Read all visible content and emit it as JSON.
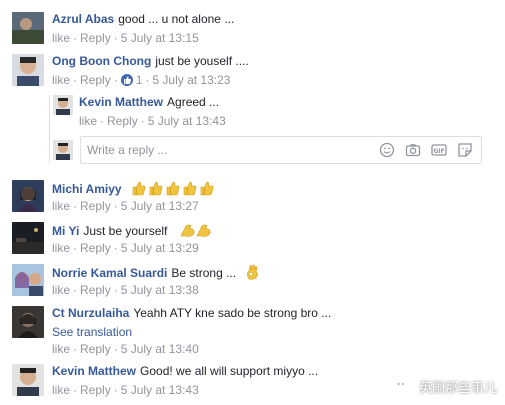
{
  "actions": {
    "like": "like",
    "reply": "Reply",
    "dot": "·"
  },
  "comments": [
    {
      "name": "Azrul Abas",
      "text": "good ... u not alone ...",
      "time": "5 July at 13:15"
    },
    {
      "name": "Ong Boon Chong",
      "text": "just be youself ....",
      "likes": "1",
      "time": "5 July at 13:23"
    },
    {
      "name": "Kevin Matthew",
      "text": "Agreed ...",
      "time": "5 July at 13:43"
    },
    {
      "name": "Michi Amiyy",
      "text": "",
      "time": "5 July at 13:27"
    },
    {
      "name": "Mi Yi",
      "text": "Just be yourself",
      "time": "5 July at 13:29"
    },
    {
      "name": "Norrie Kamal Suardi",
      "text": "Be strong ...",
      "time": "5 July at 13:38"
    },
    {
      "name": "Ct Nurzulaiha",
      "text": "Yeahh ATY kne sado be strong bro ...",
      "translation": "See translation",
      "time": "5 July at 13:40"
    },
    {
      "name": "Kevin Matthew",
      "text": "Good! we all will support miyyo ...",
      "time": "5 July at 13:43"
    }
  ],
  "reply_box": {
    "placeholder": "Write a reply ..."
  },
  "watermark": {
    "text": "英国那些事儿"
  },
  "colors": {
    "name_blue": "#365899",
    "meta_gray": "#90949c",
    "like_blue": "#4267b2",
    "emoji_yellow": "#f0c43f"
  },
  "icons": [
    "smiley-icon",
    "camera-icon",
    "gif-icon",
    "sticker-icon",
    "thumbs-up-icon",
    "muscle-icon",
    "ok-hand-icon"
  ]
}
